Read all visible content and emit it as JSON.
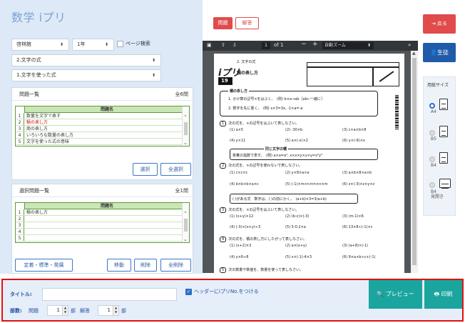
{
  "app": {
    "title": "数学 iプリ"
  },
  "filters": {
    "textbook": "啓林館",
    "grade": "1年",
    "page_search": "ページ検索",
    "chapter": "2.文字の式",
    "section": "1.文字を使った式"
  },
  "problem_list": {
    "title": "問題一覧",
    "count": "全6問",
    "column": "問題名",
    "rows": [
      {
        "num": "1",
        "name": "数量を文字で表す"
      },
      {
        "num": "2",
        "name": "積の表し方"
      },
      {
        "num": "3",
        "name": "商の表し方"
      },
      {
        "num": "4",
        "name": "いろいろな数量の表し方"
      },
      {
        "num": "5",
        "name": "文字を使った式の意味"
      }
    ],
    "select_label": "選択",
    "select_all_label": "全選択"
  },
  "selected_list": {
    "title": "選択問題一覧",
    "count": "全1問",
    "column": "問題名",
    "rows": [
      {
        "num": "1",
        "name": "積の表し方"
      },
      {
        "num": "2",
        "name": ""
      },
      {
        "num": "3",
        "name": ""
      },
      {
        "num": "4",
        "name": ""
      },
      {
        "num": "5",
        "name": ""
      }
    ],
    "level_label": "定着・標準・発展",
    "move_label": "移動",
    "delete_label": "削除",
    "delete_all_label": "全削除"
  },
  "viewer": {
    "tab_problem": "問題",
    "tab_answer": "解答",
    "page_current": "1",
    "page_total": "of 1",
    "zoom": "自動ズーム",
    "doc": {
      "section_no": "2. 文字の式",
      "logo": "iプリ",
      "logo_no": "19",
      "heading": "積の表し方",
      "rule_title": "積の表し方",
      "rule1": "1. かけ算の記号×をはぶく。　(例) b×a→ab［ab←一緒に］",
      "rule2": "2. 数字を先に書く。　(例) x×3=3x, -1×a=-a",
      "q1": "次の式を、×の記号をはぶいて表しなさい。",
      "q1a": "(1) a×5",
      "q1b": "(2) -30×b",
      "q1c": "(3) c×a×b×8",
      "q1d": "(4) y×11",
      "q1e": "(5) a×(-x)×2",
      "q1f": "(6) y×(-6)×x",
      "note_title": "同じ文字の積",
      "note": "累乗の指数で表す。　(例) a×a=a², x×x×y×y×y=x²y³",
      "q2": "次の式を、×の記号を使わないで表しなさい。",
      "q2a": "(1) c×c×c",
      "q2b": "(2) y×8×a×a",
      "q2c": "(3) a×b×8×a×b",
      "q2d": "(4) b×b×b×a×c",
      "q2e": "(5) (-1)×m×n×m×n×m",
      "q2f": "(6) z×(-3)×z×y×z",
      "note2": "( )がある式　数字は、( )の前にかく。　(a+b)×3=3(a+b)",
      "q3": "次の式を、×の記号をはぶいて表しなさい。",
      "q3a": "(1) (x+y)×12",
      "q3b": "(2) (b-c)×(-3)",
      "q3c": "(3) (m-1)×6",
      "q3d": "(4) (-3)×(x+y)÷3",
      "q3e": "(5) 5-0.2×a",
      "q3f": "(6) 13×8÷(-1)×c",
      "q4": "次の式を、積の表し方にしたがって表しなさい。",
      "q4a": "(1) (x+2)×3",
      "q4b": "(2) a×(x+y)",
      "q4c": "(3) (a+8)×(-1)",
      "q4d": "(4) y×6÷8",
      "q4e": "(5) x×(-1)-4×3",
      "q4f": "(6) 9×a+b÷c+(-1)",
      "q5": "次の数量や数値を、数量を使って表しなさい。"
    }
  },
  "side": {
    "back_label": "戻る",
    "student_label": "生徒",
    "paper_size_label": "用紙サイズ",
    "options": [
      {
        "label": "A4",
        "selected": true
      },
      {
        "label": "B5",
        "selected": false
      },
      {
        "label": "B4",
        "selected": false
      },
      {
        "label": "B4\n見開き",
        "selected": false
      }
    ]
  },
  "bottom": {
    "title_label": "タイトル:",
    "title_value": "",
    "header_check_label": "ヘッダーにiプリNo.をつける",
    "copies_label": "部数:",
    "problem_label": "問題",
    "problem_copies": "1",
    "unit1": "部",
    "answer_label": "解答",
    "answer_copies": "1",
    "unit2": "部",
    "preview_label": "プレビュー",
    "print_label": "印刷"
  },
  "colors": {
    "accent_red": "#e04b4b",
    "primary_blue": "#1f5ba8",
    "teal": "#1aa59e",
    "panel_bg": "#dde9f7",
    "grid_green": "#c9e6b6",
    "highlight_red": "#e01010"
  }
}
